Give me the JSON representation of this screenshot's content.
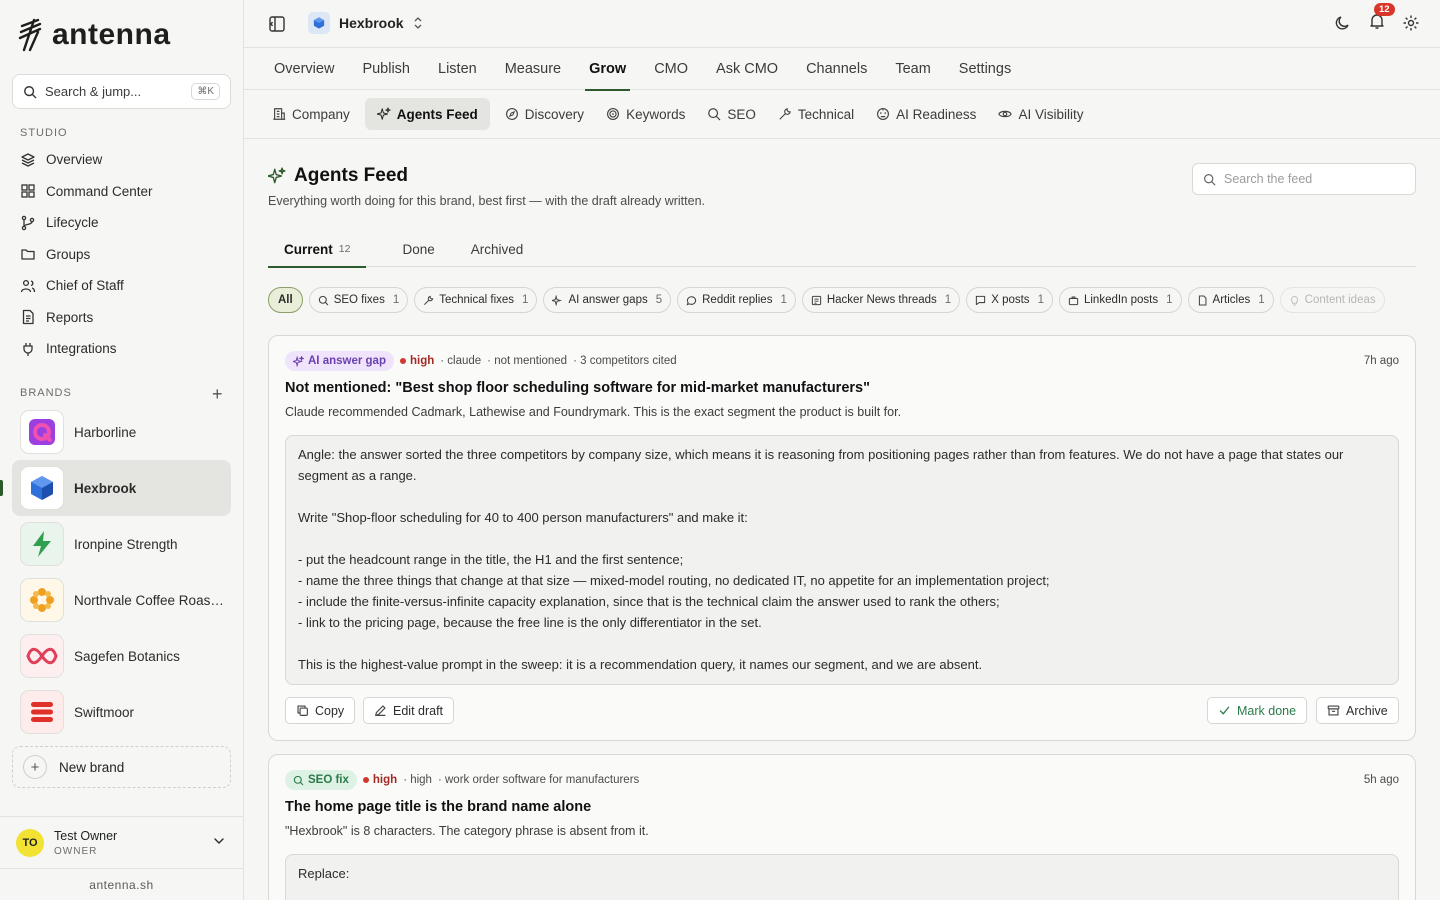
{
  "app": {
    "name": "antenna",
    "domain": "antenna.sh"
  },
  "sidebar": {
    "search_placeholder": "Search & jump...",
    "search_shortcut": "⌘K",
    "studio_label": "STUDIO",
    "studio_items": [
      {
        "label": "Overview",
        "icon": "layers-icon"
      },
      {
        "label": "Command Center",
        "icon": "grid-icon"
      },
      {
        "label": "Lifecycle",
        "icon": "branch-icon"
      },
      {
        "label": "Groups",
        "icon": "folder-icon"
      },
      {
        "label": "Chief of Staff",
        "icon": "users-icon"
      },
      {
        "label": "Reports",
        "icon": "document-icon"
      },
      {
        "label": "Integrations",
        "icon": "plug-icon"
      }
    ],
    "brands_label": "BRANDS",
    "brands": [
      {
        "name": "Harborline",
        "color": "#8e3ad6"
      },
      {
        "name": "Hexbrook",
        "color": "#2f6fd8",
        "active": true
      },
      {
        "name": "Ironpine Strength",
        "color": "#2ea04f"
      },
      {
        "name": "Northvale Coffee Roast...",
        "color": "#f0a020"
      },
      {
        "name": "Sagefen Botanics",
        "color": "#e0405a"
      },
      {
        "name": "Swiftmoor",
        "color": "#e0302a"
      }
    ],
    "new_brand_label": "New brand",
    "user": {
      "initials": "TO",
      "name": "Test Owner",
      "role": "OWNER"
    }
  },
  "topbar": {
    "workspace": "Hexbrook",
    "notifications": "12"
  },
  "main_tabs": [
    "Overview",
    "Publish",
    "Listen",
    "Measure",
    "Grow",
    "CMO",
    "Ask CMO",
    "Channels",
    "Team",
    "Settings"
  ],
  "main_tab_active": "Grow",
  "sub_tabs": [
    "Company",
    "Agents Feed",
    "Discovery",
    "Keywords",
    "SEO",
    "Technical",
    "AI Readiness",
    "AI Visibility"
  ],
  "feed": {
    "title": "Agents Feed",
    "subtitle": "Everything worth doing for this brand, best first — with the draft already written.",
    "search_placeholder": "Search the feed",
    "state_tabs": [
      {
        "label": "Current",
        "count": "12"
      },
      {
        "label": "Done",
        "count": ""
      },
      {
        "label": "Archived",
        "count": ""
      }
    ],
    "filters": [
      {
        "label": "All",
        "count": ""
      },
      {
        "label": "SEO fixes",
        "count": "1"
      },
      {
        "label": "Technical fixes",
        "count": "1"
      },
      {
        "label": "AI answer gaps",
        "count": "5"
      },
      {
        "label": "Reddit replies",
        "count": "1"
      },
      {
        "label": "Hacker News threads",
        "count": "1"
      },
      {
        "label": "X posts",
        "count": "1"
      },
      {
        "label": "LinkedIn posts",
        "count": "1"
      },
      {
        "label": "Articles",
        "count": "1"
      },
      {
        "label": "Content ideas",
        "count": ""
      }
    ],
    "cards": [
      {
        "tag": "AI answer gap",
        "priority": "high",
        "meta": [
          "· claude",
          "· not mentioned",
          "· 3 competitors cited"
        ],
        "time": "7h ago",
        "title": "Not mentioned: \"Best shop floor scheduling software for mid-market manufacturers\"",
        "desc": "Claude recommended Cadmark, Lathewise and Foundrymark. This is the exact segment the product is built for.",
        "draft": [
          "Angle: the answer sorted the three competitors by company size, which means it is reasoning from positioning pages rather than from features. We do not have a page that states our segment as a range.",
          "",
          "Write \"Shop-floor scheduling for 40 to 400 person manufacturers\" and make it:",
          "",
          "- put the headcount range in the title, the H1 and the first sentence;",
          "- name the three things that change at that size — mixed-model routing, no dedicated IT, no appetite for an implementation project;",
          "- include the finite-versus-infinite capacity explanation, since that is the technical claim the answer used to rank the others;",
          "- link to the pricing page, because the free line is the only differentiator in the set.",
          "",
          "This is the highest-value prompt in the sweep: it is a recommendation query, it names our segment, and we are absent."
        ],
        "actions": {
          "copy": "Copy",
          "edit": "Edit draft",
          "done": "Mark done",
          "archive": "Archive"
        }
      },
      {
        "tag": "SEO fix",
        "priority": "high",
        "meta": [
          "· high",
          "· work order software for manufacturers"
        ],
        "time": "5h ago",
        "title": "The home page title is the brand name alone",
        "desc": "\"Hexbrook\" is 8 characters. The category phrase is absent from it.",
        "draft": [
          "Replace:"
        ]
      }
    ]
  }
}
